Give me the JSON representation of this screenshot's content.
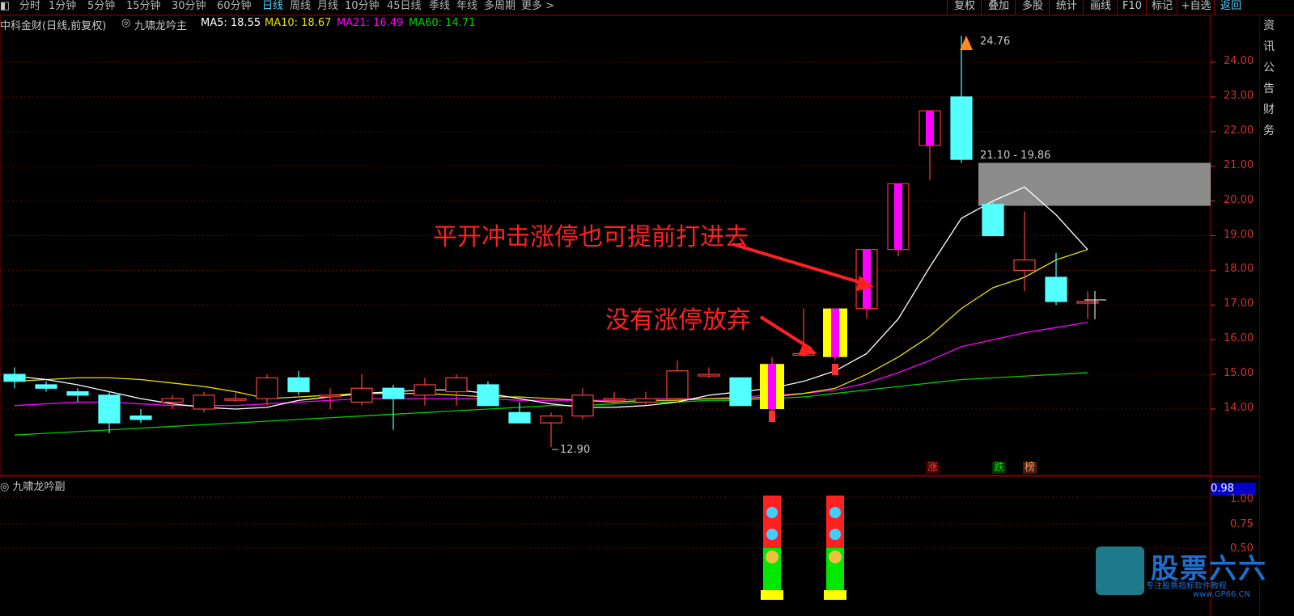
{
  "toolbar": {
    "periods": [
      "分时",
      "1分钟",
      "5分钟",
      "15分钟",
      "30分钟",
      "60分钟",
      "日线",
      "周线",
      "月线",
      "10分钟",
      "45日线",
      "季线",
      "年线",
      "多周期",
      "更多 >"
    ],
    "active_period": "日线",
    "right_buttons": [
      "复权",
      "叠加",
      "多股",
      "统计",
      "画线",
      "F10",
      "标记",
      "+自选",
      "返回"
    ]
  },
  "legend": {
    "stock_title": "中科金财(日线,前复权)",
    "indicator": "九啸龙吟主",
    "ma5": "MA5: 18.55",
    "ma10": "MA10: 18.67",
    "ma21": "MA21: 16.49",
    "ma60": "MA60: 14.71"
  },
  "colors": {
    "up": "#ff4040",
    "down": "#54ffff",
    "ma5": "#ffffff",
    "ma10": "#e8e000",
    "ma21": "#ff00ff",
    "ma60": "#00d000",
    "grid": "#6a0000",
    "axis_text": "#d23030"
  },
  "price_axis": [
    "24.00",
    "23.00",
    "22.00",
    "21.00",
    "20.00",
    "19.00",
    "18.00",
    "17.00",
    "16.00",
    "15.00",
    "14.00"
  ],
  "sub_axis": [
    "1.00",
    "0.75",
    "0.50"
  ],
  "annotations": {
    "high": "24.76",
    "low": "12.90",
    "zone": "21.10 - 19.86",
    "text1": "平开冲击涨停也可提前打进去",
    "text2": "没有涨停放弃"
  },
  "tags": {
    "zhang": "涨",
    "die": "跌",
    "bang": "榜"
  },
  "sub_panel": {
    "title": "九啸龙吟副",
    "value": "0.98"
  },
  "right_strip_text": "资讯公告财务",
  "logo": {
    "name": "股票六六",
    "slogan": "专注股票指标软件教程",
    "url": "www.GP66.CN"
  },
  "chart_data": {
    "type": "candlestick",
    "ylim": [
      12.5,
      25.0
    ],
    "candles": [
      {
        "o": 15.0,
        "h": 15.2,
        "l": 14.6,
        "c": 14.8
      },
      {
        "o": 14.7,
        "h": 14.8,
        "l": 14.5,
        "c": 14.6
      },
      {
        "o": 14.5,
        "h": 14.6,
        "l": 14.2,
        "c": 14.4
      },
      {
        "o": 14.4,
        "h": 14.5,
        "l": 13.3,
        "c": 13.6
      },
      {
        "o": 13.8,
        "h": 14.0,
        "l": 13.6,
        "c": 13.7
      },
      {
        "o": 14.2,
        "h": 14.4,
        "l": 14.0,
        "c": 14.3
      },
      {
        "o": 14.0,
        "h": 14.5,
        "l": 13.9,
        "c": 14.4
      },
      {
        "o": 14.3,
        "h": 14.5,
        "l": 14.2,
        "c": 14.3
      },
      {
        "o": 14.3,
        "h": 15.0,
        "l": 14.1,
        "c": 14.9
      },
      {
        "o": 14.9,
        "h": 15.1,
        "l": 14.4,
        "c": 14.5
      },
      {
        "o": 14.4,
        "h": 14.6,
        "l": 14.0,
        "c": 14.4
      },
      {
        "o": 14.2,
        "h": 15.0,
        "l": 14.1,
        "c": 14.6
      },
      {
        "o": 14.6,
        "h": 14.7,
        "l": 13.4,
        "c": 14.3
      },
      {
        "o": 14.4,
        "h": 14.9,
        "l": 14.1,
        "c": 14.7
      },
      {
        "o": 14.5,
        "h": 15.0,
        "l": 14.1,
        "c": 14.9
      },
      {
        "o": 14.7,
        "h": 14.8,
        "l": 14.1,
        "c": 14.1
      },
      {
        "o": 13.9,
        "h": 14.2,
        "l": 13.6,
        "c": 13.6
      },
      {
        "o": 13.6,
        "h": 13.9,
        "l": 12.9,
        "c": 13.8
      },
      {
        "o": 13.8,
        "h": 14.6,
        "l": 13.7,
        "c": 14.4
      },
      {
        "o": 14.3,
        "h": 14.5,
        "l": 14.2,
        "c": 14.3
      },
      {
        "o": 14.2,
        "h": 14.5,
        "l": 14.1,
        "c": 14.3
      },
      {
        "o": 14.3,
        "h": 15.4,
        "l": 14.2,
        "c": 15.1
      },
      {
        "o": 15.0,
        "h": 15.2,
        "l": 14.9,
        "c": 15.0
      },
      {
        "o": 14.9,
        "h": 14.9,
        "l": 14.1,
        "c": 14.1
      },
      {
        "o": 14.0,
        "h": 15.5,
        "l": 13.8,
        "c": 15.3
      },
      {
        "o": 15.6,
        "h": 16.9,
        "l": 15.5,
        "c": 15.6
      },
      {
        "o": 15.5,
        "h": 16.9,
        "l": 15.4,
        "c": 16.9
      },
      {
        "o": 16.9,
        "h": 18.6,
        "l": 16.6,
        "c": 18.6
      },
      {
        "o": 18.6,
        "h": 20.5,
        "l": 18.4,
        "c": 20.5
      },
      {
        "o": 21.6,
        "h": 22.6,
        "l": 20.6,
        "c": 22.6
      },
      {
        "o": 23.0,
        "h": 24.76,
        "l": 21.1,
        "c": 21.2
      },
      {
        "o": 19.9,
        "h": 20.0,
        "l": 19.0,
        "c": 19.0
      },
      {
        "o": 18.0,
        "h": 19.7,
        "l": 17.4,
        "c": 18.3
      },
      {
        "o": 17.8,
        "h": 18.5,
        "l": 17.0,
        "c": 17.1
      },
      {
        "o": 17.1,
        "h": 17.4,
        "l": 16.6,
        "c": 17.1
      }
    ],
    "ma5": [
      14.95,
      14.85,
      14.7,
      14.5,
      14.3,
      14.15,
      14.05,
      14.0,
      14.05,
      14.25,
      14.35,
      14.45,
      14.5,
      14.55,
      14.55,
      14.45,
      14.3,
      14.15,
      14.05,
      14.05,
      14.1,
      14.2,
      14.4,
      14.5,
      14.6,
      14.8,
      15.1,
      15.6,
      16.6,
      18.1,
      19.5,
      20.0,
      20.4,
      19.6,
      18.6
    ],
    "ma10": [
      14.8,
      14.85,
      14.9,
      14.9,
      14.85,
      14.75,
      14.65,
      14.5,
      14.3,
      14.35,
      14.4,
      14.45,
      14.45,
      14.45,
      14.4,
      14.35,
      14.35,
      14.3,
      14.25,
      14.2,
      14.25,
      14.25,
      14.3,
      14.3,
      14.35,
      14.45,
      14.6,
      15.0,
      15.5,
      16.1,
      16.9,
      17.5,
      17.8,
      18.3,
      18.6
    ],
    "ma21": [
      14.1,
      14.15,
      14.2,
      14.2,
      14.15,
      14.1,
      14.1,
      14.1,
      14.15,
      14.2,
      14.25,
      14.3,
      14.3,
      14.3,
      14.3,
      14.3,
      14.25,
      14.25,
      14.25,
      14.25,
      14.3,
      14.3,
      14.3,
      14.35,
      14.4,
      14.45,
      14.55,
      14.75,
      15.05,
      15.4,
      15.8,
      16.0,
      16.2,
      16.35,
      16.5
    ],
    "ma60": [
      13.25,
      13.3,
      13.35,
      13.4,
      13.45,
      13.5,
      13.55,
      13.6,
      13.65,
      13.7,
      13.75,
      13.8,
      13.85,
      13.9,
      13.95,
      14.0,
      14.05,
      14.1,
      14.1,
      14.15,
      14.2,
      14.2,
      14.25,
      14.25,
      14.3,
      14.35,
      14.45,
      14.55,
      14.65,
      14.75,
      14.85,
      14.9,
      14.95,
      15.0,
      15.05
    ],
    "zone": [
      19.86,
      21.1
    ],
    "highlight_days": [
      24,
      26
    ],
    "sub_bars": [
      24,
      26
    ]
  }
}
